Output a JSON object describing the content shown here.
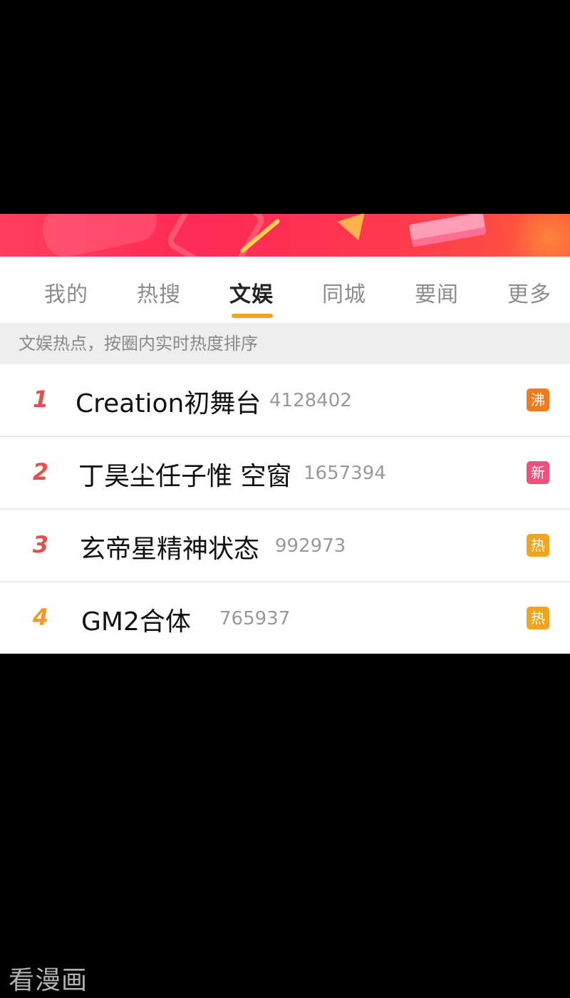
{
  "tabs": [
    {
      "label": "我的",
      "active": false
    },
    {
      "label": "热搜",
      "active": false
    },
    {
      "label": "文娱",
      "active": true
    },
    {
      "label": "同城",
      "active": false
    },
    {
      "label": "要闻",
      "active": false
    },
    {
      "label": "更多",
      "active": false
    }
  ],
  "subheader": "文娱热点，按圈内实时热度排序",
  "list": [
    {
      "rank": "1",
      "title": "Creation初舞台",
      "count": "4128402",
      "badge": "沸"
    },
    {
      "rank": "2",
      "title": "丁昊尘任子惟 空窗",
      "count": "1657394",
      "badge": "新"
    },
    {
      "rank": "3",
      "title": "玄帝星精神状态",
      "count": "992973",
      "badge": "热"
    },
    {
      "rank": "4",
      "title": "GM2合体",
      "count": "765937",
      "badge": "热"
    }
  ],
  "colors": {
    "accent": "#f3a41f",
    "rank_red": "#e35050",
    "rank_orange": "#f09a2a",
    "badge_boil": "#f07a1e",
    "badge_new": "#f2507a",
    "badge_hot": "#f3a41f"
  },
  "watermark": "看漫画"
}
